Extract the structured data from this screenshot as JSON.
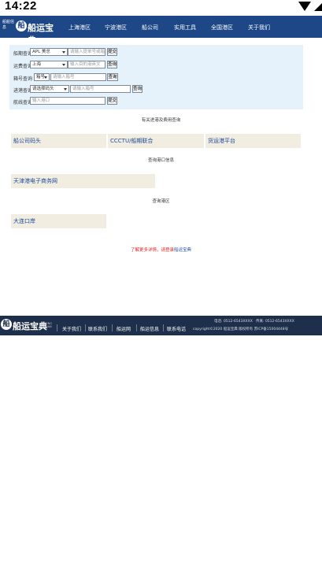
{
  "status_bar": {
    "time": "14:22",
    "icons": [
      "wifi-icon",
      "signal-icon",
      "battery-icon"
    ]
  },
  "header": {
    "brand_small": "船舶信息",
    "logo_text": "船运宝典",
    "logo_mark": "船",
    "nav": [
      "上海港区",
      "宁波港区",
      "船公司",
      "实用工具",
      "全国港区",
      "关于我们"
    ]
  },
  "search": {
    "rows": [
      {
        "label": "船期查询",
        "select": "APL 美总",
        "input_placeholder": "请输入提单号或箱号",
        "button": "提交"
      },
      {
        "label": "运费查询",
        "select": "上海",
        "input_placeholder": "输入目的港英文",
        "button": "查询"
      },
      {
        "label": "箱号查询",
        "select": "箱号",
        "input_placeholder": "请输入箱号",
        "button": "查询"
      },
      {
        "label": "进港查询",
        "select": "请选择码头",
        "input_placeholder": "请输入箱号",
        "button": "查询"
      },
      {
        "label": "航线查询",
        "select": "",
        "input_placeholder": "输入港口",
        "button": "提交"
      }
    ]
  },
  "notes": {
    "note1": "有关进港及费用查询",
    "note2": "查询港口信息",
    "note3": "查询港区",
    "red": "了解更多详情，请登录",
    "red_link": "船运宝典"
  },
  "sections": {
    "row1": [
      "船公司码头",
      "CCCTU/船期联合",
      "货运港平台"
    ],
    "row2": "天津港电子商务网",
    "row3": "大连口岸"
  },
  "footer": {
    "logo_text": "船运宝典",
    "logo_mark": "船",
    "logo_sub": "ZHONG CHUAN",
    "links": [
      "关于我们",
      "联系我们",
      "船运网",
      "船运信息",
      "联系电话"
    ],
    "contact1": "电话: 0512-6543XXXX",
    "contact2": "传真: 0512-6543XXXX",
    "copyright": "copyright©2020 船运宝典 版权所有 苏ICP备15004448号"
  }
}
